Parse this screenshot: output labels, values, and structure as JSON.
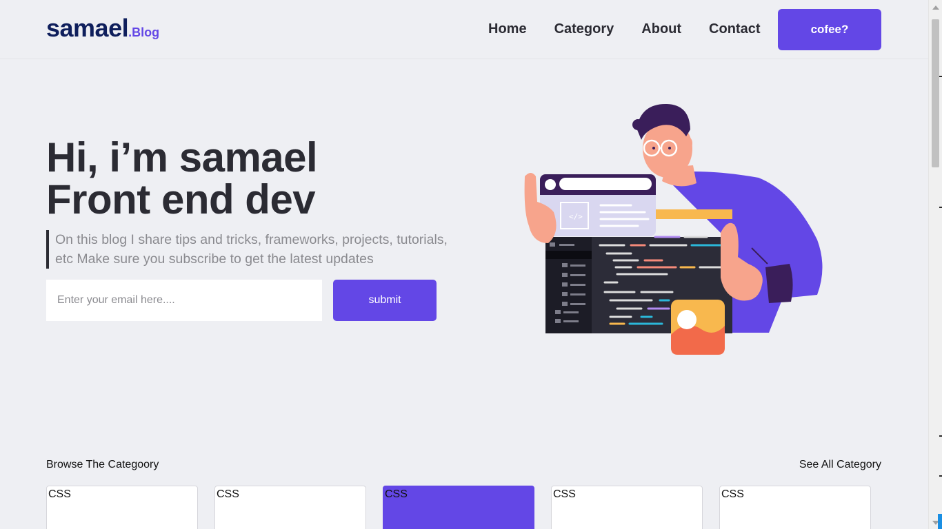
{
  "header": {
    "logo_main": "samael",
    "logo_suffix": ".Blog",
    "nav": [
      "Home",
      "Category",
      "About",
      "Contact"
    ],
    "cta_label": "cofee?"
  },
  "hero": {
    "title_line1": "Hi, i’m samael",
    "title_line2": "Front end dev",
    "description": "On this blog I share tips and tricks, frameworks, projects, tutorials, etc Make sure you subscribe to get the latest updates",
    "email_placeholder": "Enter your email here....",
    "submit_label": "submit"
  },
  "categories": {
    "title": "Browse The Categoory",
    "see_all": "See All Category",
    "items": [
      {
        "label": "CSS",
        "active": false
      },
      {
        "label": "CSS",
        "active": false
      },
      {
        "label": "CSS",
        "active": true
      },
      {
        "label": "CSS",
        "active": false
      },
      {
        "label": "CSS",
        "active": false
      }
    ]
  },
  "colors": {
    "accent": "#6347e6",
    "logo": "#0f1f5c",
    "background": "#eeeff3",
    "text": "#2b2b33"
  },
  "icons": [
    "developer-illustration"
  ]
}
